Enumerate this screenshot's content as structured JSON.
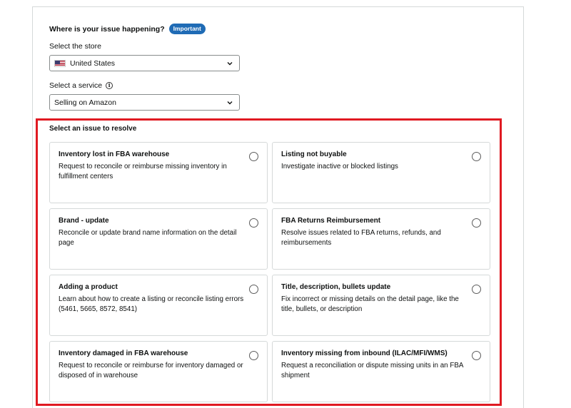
{
  "where": {
    "label": "Where is your issue happening?",
    "badge": "Important"
  },
  "store": {
    "label": "Select the store",
    "value": "United States",
    "flag_icon": "us-flag-icon"
  },
  "service": {
    "label": "Select a service",
    "value": "Selling on Amazon",
    "info_icon": "info-icon"
  },
  "issues": {
    "label": "Select an issue to resolve",
    "highlight_color": "#e01a22",
    "cards": [
      {
        "title": "Inventory lost in FBA warehouse",
        "desc": "Request to reconcile or reimburse missing inventory in fulfillment centers"
      },
      {
        "title": "Listing not buyable",
        "desc": "Investigate inactive or blocked listings"
      },
      {
        "title": "Brand - update",
        "desc": "Reconcile or update brand name information on the detail page"
      },
      {
        "title": "FBA Returns Reimbursement",
        "desc": "Resolve issues related to FBA returns, refunds, and reimbursements"
      },
      {
        "title": "Adding a product",
        "desc": "Learn about how to create a listing or reconcile listing errors (5461, 5665, 8572, 8541)"
      },
      {
        "title": "Title, description, bullets update",
        "desc": "Fix incorrect or missing details on the detail page, like the title, bullets, or description"
      },
      {
        "title": "Inventory damaged in FBA warehouse",
        "desc": "Request to reconcile or reimburse for inventory damaged or disposed of in warehouse"
      },
      {
        "title": "Inventory missing from inbound (ILAC/MFI/WMS)",
        "desc": "Request a reconciliation or dispute missing units in an FBA shipment"
      }
    ]
  }
}
